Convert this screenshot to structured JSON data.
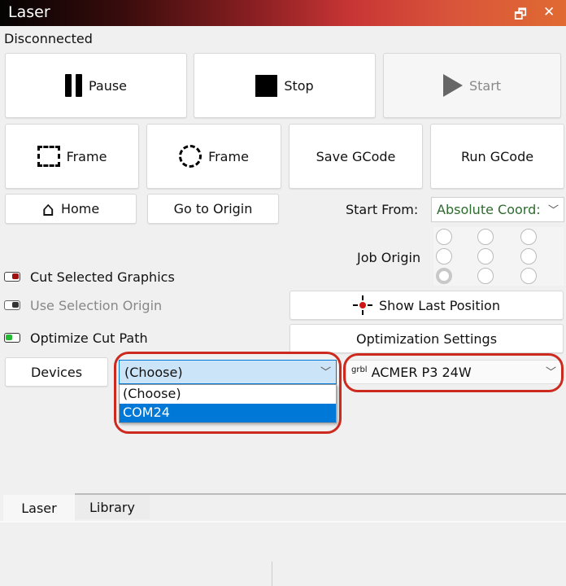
{
  "window": {
    "title": "Laser",
    "restore_icon": "restore-icon",
    "close_icon": "close-icon",
    "close_label": "✕"
  },
  "status": "Disconnected",
  "controls": {
    "pause": "Pause",
    "stop": "Stop",
    "start": "Start",
    "frame_rect": "Frame",
    "frame_circle": "Frame",
    "save_gcode": "Save GCode",
    "run_gcode": "Run GCode",
    "home": "Home",
    "go_to_origin": "Go to Origin"
  },
  "start_from": {
    "label": "Start From:",
    "value": "Absolute Coords",
    "display": "Absolute Coord:"
  },
  "job_origin": {
    "label": "Job Origin",
    "selected": "bottom-left"
  },
  "options": {
    "cut_selected": {
      "label": "Cut Selected Graphics",
      "state": "off",
      "color": "#a01010"
    },
    "use_selection_origin": {
      "label": "Use Selection Origin",
      "state": "disabled"
    },
    "optimize_cut_path": {
      "label": "Optimize Cut Path",
      "state": "on",
      "color": "#22bb33"
    }
  },
  "buttons": {
    "show_last_position": "Show Last Position",
    "optimization_settings": "Optimization Settings",
    "devices": "Devices"
  },
  "port_combo": {
    "value": "(Choose)",
    "options": [
      "(Choose)",
      "COM24"
    ],
    "highlighted": "COM24"
  },
  "device_combo": {
    "prefix": "grbl",
    "value": "ACMER P3 24W"
  },
  "tabs": [
    {
      "label": "Laser",
      "active": true
    },
    {
      "label": "Library",
      "active": false
    }
  ],
  "colors": {
    "accent": "#0078d7",
    "annotation": "#cc2a1e",
    "start_from_text": "#2e6b2e"
  }
}
